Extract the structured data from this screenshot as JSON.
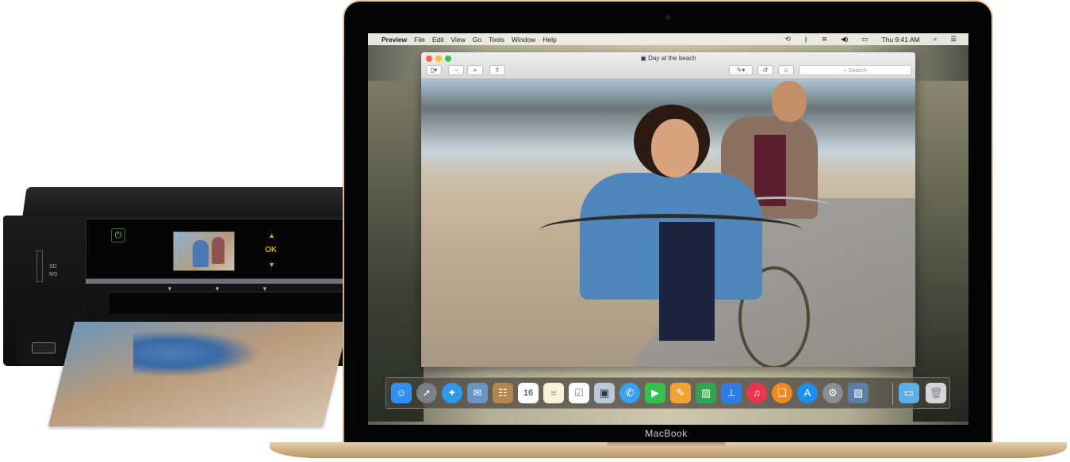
{
  "menubar": {
    "apple": "",
    "app_name": "Preview",
    "menus": [
      "File",
      "Edit",
      "View",
      "Go",
      "Tools",
      "Window",
      "Help"
    ],
    "status": {
      "clock": "Thu 9:41 AM"
    }
  },
  "window": {
    "title": "Day at the beach",
    "search_placeholder": "Search"
  },
  "printer": {
    "ok_label": "OK",
    "sd_label": "SD",
    "ms_label": "MS"
  },
  "device": {
    "label": "MacBook"
  },
  "dock": {
    "items": [
      "finder-icon",
      "launchpad-icon",
      "safari-icon",
      "mail-icon",
      "contacts-icon",
      "calendar-icon",
      "notes-icon",
      "reminders-icon",
      "preview-icon",
      "messages-icon",
      "facetime-icon",
      "pages-icon",
      "numbers-icon",
      "keynote-icon",
      "itunes-icon",
      "ibooks-icon",
      "app-store-icon",
      "system-preferences-icon",
      "photos-icon",
      "downloads-folder-icon",
      "trash-icon"
    ],
    "calendar_day": "16"
  },
  "colors": {
    "gold": "#d6b48a",
    "traffic_red": "#fc5f57",
    "traffic_yellow": "#fdbc2e",
    "traffic_green": "#33c748"
  }
}
